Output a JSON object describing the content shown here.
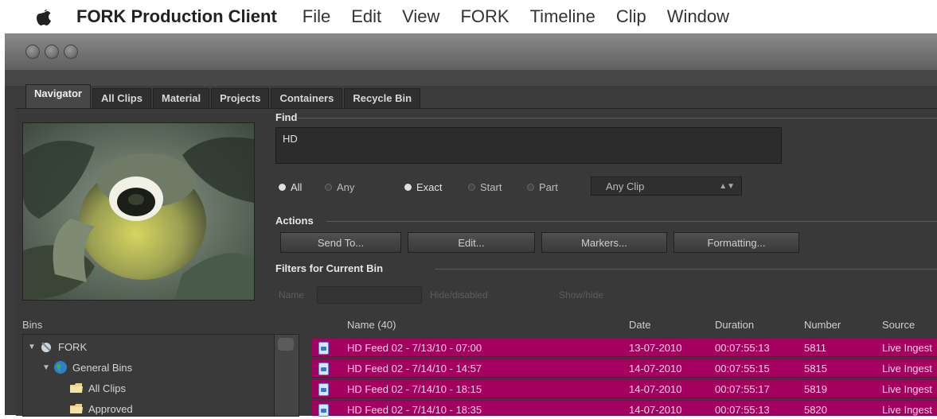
{
  "menubar": {
    "app_name": "FORK Production Client",
    "menus": [
      "File",
      "Edit",
      "View",
      "FORK",
      "Timeline",
      "Clip",
      "Window"
    ]
  },
  "tabs": [
    "Navigator",
    "All Clips",
    "Material",
    "Projects",
    "Containers",
    "Recycle Bin"
  ],
  "find": {
    "label": "Find",
    "value": "HD",
    "match_mode": [
      {
        "label": "All",
        "selected": true
      },
      {
        "label": "Any",
        "selected": false
      }
    ],
    "match_type": [
      {
        "label": "Exact",
        "selected": true
      },
      {
        "label": "Start",
        "selected": false
      },
      {
        "label": "Part",
        "selected": false
      }
    ],
    "clip_filter": "Any Clip"
  },
  "actions": {
    "label": "Actions",
    "buttons": [
      "Send To...",
      "Edit...",
      "Markers...",
      "Formatting..."
    ]
  },
  "filters": {
    "label": "Filters for Current Bin",
    "name_label": "Name",
    "option1": "Hide/disabled",
    "option2": "Show/hide"
  },
  "bins": {
    "header": "Bins",
    "tree": [
      {
        "label": "FORK",
        "level": 0,
        "icon": "satellite-icon"
      },
      {
        "label": "General Bins",
        "level": 1,
        "icon": "globe-icon"
      },
      {
        "label": "All Clips",
        "level": 2,
        "icon": "folder-icon"
      },
      {
        "label": "Approved",
        "level": 2,
        "icon": "folder-icon"
      }
    ]
  },
  "clips": {
    "columns": [
      "Name (40)",
      "Date",
      "Duration",
      "Number",
      "Source"
    ],
    "rows": [
      {
        "name": "HD Feed 02 - 7/13/10 - 07:00",
        "date": "13-07-2010",
        "duration": "00:07:55:13",
        "number": "5811",
        "source": "Live Ingest"
      },
      {
        "name": "HD Feed 02 - 7/14/10 - 14:57",
        "date": "14-07-2010",
        "duration": "00:07:55:15",
        "number": "5815",
        "source": "Live Ingest"
      },
      {
        "name": "HD Feed 02 - 7/14/10 - 18:15",
        "date": "14-07-2010",
        "duration": "00:07:55:17",
        "number": "5819",
        "source": "Live Ingest"
      },
      {
        "name": "HD Feed 02 - 7/14/10 - 18:35",
        "date": "14-07-2010",
        "duration": "00:07:55:13",
        "number": "5820",
        "source": "Live Ingest"
      }
    ],
    "row_color": "#a3005f"
  }
}
